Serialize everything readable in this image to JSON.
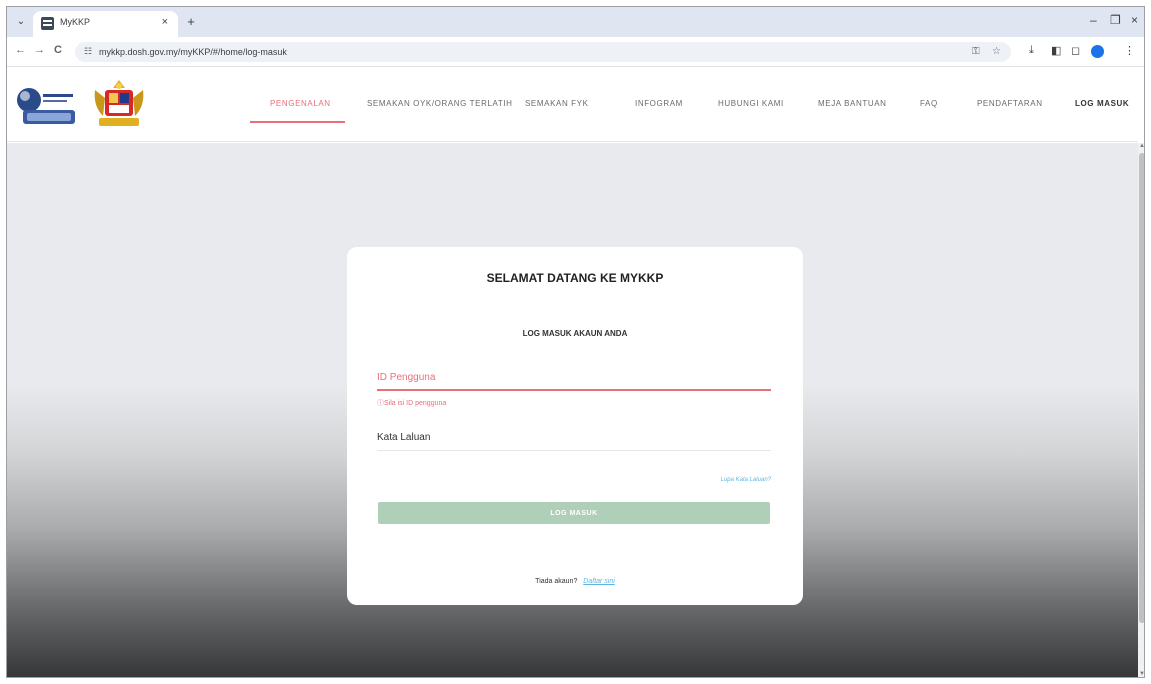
{
  "browser": {
    "tab_title": "MyKKP",
    "tab_close": "×",
    "new_tab": "+",
    "tab_list": "⌄",
    "url": "mykkp.dosh.gov.my/myKKP/#/home/log-masuk",
    "window_minimize": "–",
    "window_restore": "❐",
    "window_close": "×",
    "back": "←",
    "forward": "→",
    "reload": "C",
    "profile_initial": ""
  },
  "site": {
    "nav": [
      {
        "label": "PENGENALAN"
      },
      {
        "label": "SEMAKAN OYK/ORANG TERLATIH"
      },
      {
        "label": "SEMAKAN FYK"
      },
      {
        "label": "INFOGRAM"
      },
      {
        "label": "HUBUNGI KAMI"
      },
      {
        "label": "MEJA BANTUAN"
      },
      {
        "label": "FAQ"
      },
      {
        "label": "PENDAFTARAN"
      },
      {
        "label": "LOG MASUK"
      }
    ],
    "active_nav": "PENGENALAN",
    "accent_color": "#e8707a"
  },
  "login": {
    "title": "SELAMAT DATANG KE MYKKP",
    "subtitle": "LOG MASUK AKAUN ANDA",
    "user_placeholder": "ID Pengguna",
    "user_value": "",
    "user_error": "ⓘSila isi ID pengguna",
    "pass_placeholder": "Kata Laluan",
    "pass_value": "",
    "forgot": "Lupa Kata Laluan?",
    "button": "LOG MASUK",
    "no_account": "Tiada akaun?",
    "signup": "Daftar sini",
    "button_color": "#afcfb9",
    "link_color": "#5bb8e6"
  }
}
